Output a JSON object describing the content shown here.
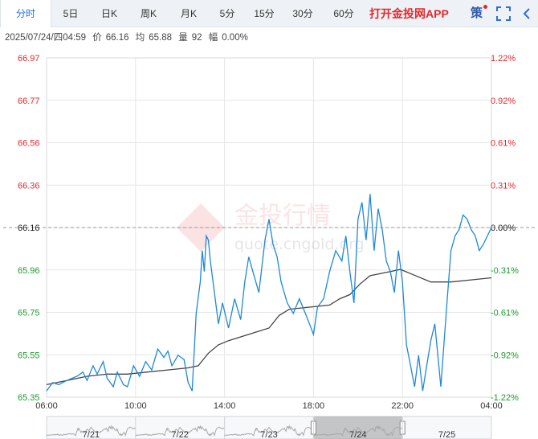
{
  "tabs": [
    {
      "label": "分时",
      "active": true
    },
    {
      "label": "5日"
    },
    {
      "label": "日K"
    },
    {
      "label": "周K"
    },
    {
      "label": "月K"
    },
    {
      "label": "5分"
    },
    {
      "label": "15分"
    },
    {
      "label": "30分"
    },
    {
      "label": "60分"
    }
  ],
  "promo_label": "打开金投网APP",
  "strategy_label": "策",
  "info": {
    "datetime": "2025/07/24/四04:59",
    "price_label": "价",
    "price": "66.16",
    "avg_label": "均",
    "avg": "65.88",
    "volume_label": "量",
    "volume": "92",
    "change_label": "幅",
    "change": "0.00%"
  },
  "watermark": {
    "brand": "金投行情",
    "url": "quote.cngold.org"
  },
  "colors": {
    "up": "#e6262b",
    "down": "#1a9a2a",
    "price_line": "#1e88d8",
    "avg_line": "#444444",
    "grid": "#e6e6e6",
    "ref_line": "#999999"
  },
  "chart_data": {
    "type": "line",
    "y_ticks": [
      "66.97",
      "66.77",
      "66.56",
      "66.36",
      "66.16",
      "65.96",
      "65.75",
      "65.55",
      "65.35"
    ],
    "pct_ticks": [
      "1.22%",
      "0.92%",
      "0.61%",
      "0.31%",
      "0.00%",
      "-0.31%",
      "-0.61%",
      "-0.92%",
      "-1.22%"
    ],
    "ylim": [
      65.35,
      66.97
    ],
    "reference_price": 66.16,
    "x_ticks": [
      "06:00",
      "10:00",
      "14:00",
      "18:00",
      "22:00",
      "04:00"
    ],
    "xlim_hours": [
      0,
      22
    ],
    "series": [
      {
        "key": "price",
        "x": [
          0.0,
          0.3,
          0.6,
          1.0,
          1.5,
          1.8,
          2.0,
          2.3,
          2.5,
          2.8,
          3.0,
          3.3,
          3.5,
          3.8,
          4.0,
          4.3,
          4.6,
          4.9,
          5.2,
          5.5,
          5.8,
          6.0,
          6.2,
          6.5,
          6.8,
          7.0,
          7.2,
          7.4,
          7.6,
          7.7,
          7.8,
          7.9,
          8.0,
          8.1,
          8.3,
          8.5,
          8.7,
          9.0,
          9.3,
          9.6,
          9.8,
          10.0,
          10.2,
          10.5,
          10.8,
          11.0,
          11.2,
          11.4,
          11.6,
          11.9,
          12.2,
          12.5,
          12.8,
          13.0,
          13.2,
          13.4,
          13.7,
          14.0,
          14.3,
          14.6,
          14.8,
          15.0,
          15.2,
          15.4,
          15.6,
          15.8,
          16.0,
          16.2,
          16.4,
          16.6,
          16.8,
          17.0,
          17.2,
          17.4,
          17.6,
          17.8,
          18.0,
          18.2,
          18.4,
          18.6,
          18.8,
          19.0,
          19.2,
          19.5,
          19.8,
          20.0,
          20.2,
          20.4,
          20.6,
          20.8,
          21.0,
          21.2,
          21.4,
          21.6,
          21.8,
          22.0
        ],
        "values": [
          65.38,
          65.42,
          65.41,
          65.43,
          65.45,
          65.47,
          65.43,
          65.5,
          65.46,
          65.52,
          65.44,
          65.4,
          65.47,
          65.41,
          65.4,
          65.5,
          65.45,
          65.52,
          65.48,
          65.58,
          65.54,
          65.57,
          65.5,
          65.55,
          65.53,
          65.42,
          65.38,
          65.75,
          65.9,
          66.05,
          65.95,
          66.12,
          66.1,
          66.0,
          65.85,
          65.7,
          65.8,
          65.68,
          65.82,
          65.72,
          65.9,
          66.02,
          65.95,
          65.85,
          66.1,
          66.2,
          66.08,
          66.02,
          65.9,
          65.8,
          65.75,
          65.82,
          65.75,
          65.7,
          65.65,
          65.78,
          65.82,
          65.95,
          66.05,
          66.0,
          66.12,
          65.95,
          65.8,
          66.2,
          66.28,
          66.1,
          66.32,
          66.05,
          66.25,
          66.15,
          66.0,
          65.95,
          65.85,
          66.05,
          65.9,
          65.6,
          65.5,
          65.4,
          65.55,
          65.38,
          65.5,
          65.62,
          65.7,
          65.4,
          65.8,
          66.05,
          66.12,
          66.15,
          66.22,
          66.2,
          66.15,
          66.12,
          66.05,
          66.08,
          66.12,
          66.16
        ]
      },
      {
        "key": "avg",
        "x": [
          0.0,
          1.0,
          2.0,
          3.0,
          4.0,
          5.0,
          6.0,
          7.0,
          7.5,
          8.0,
          8.5,
          9.0,
          10.0,
          11.0,
          11.5,
          12.0,
          13.0,
          14.0,
          14.5,
          15.0,
          15.5,
          16.0,
          17.0,
          17.5,
          18.0,
          19.0,
          20.0,
          21.0,
          22.0
        ],
        "values": [
          65.41,
          65.43,
          65.45,
          65.46,
          65.46,
          65.47,
          65.48,
          65.49,
          65.5,
          65.56,
          65.6,
          65.62,
          65.65,
          65.68,
          65.74,
          65.77,
          65.78,
          65.79,
          65.82,
          65.84,
          65.89,
          65.93,
          65.95,
          65.96,
          65.94,
          65.9,
          65.9,
          65.91,
          65.92
        ]
      }
    ],
    "navigator": {
      "labels": [
        "7/21",
        "7/22",
        "7/23",
        "7/24",
        "7/25"
      ],
      "selected_index": 3
    }
  }
}
